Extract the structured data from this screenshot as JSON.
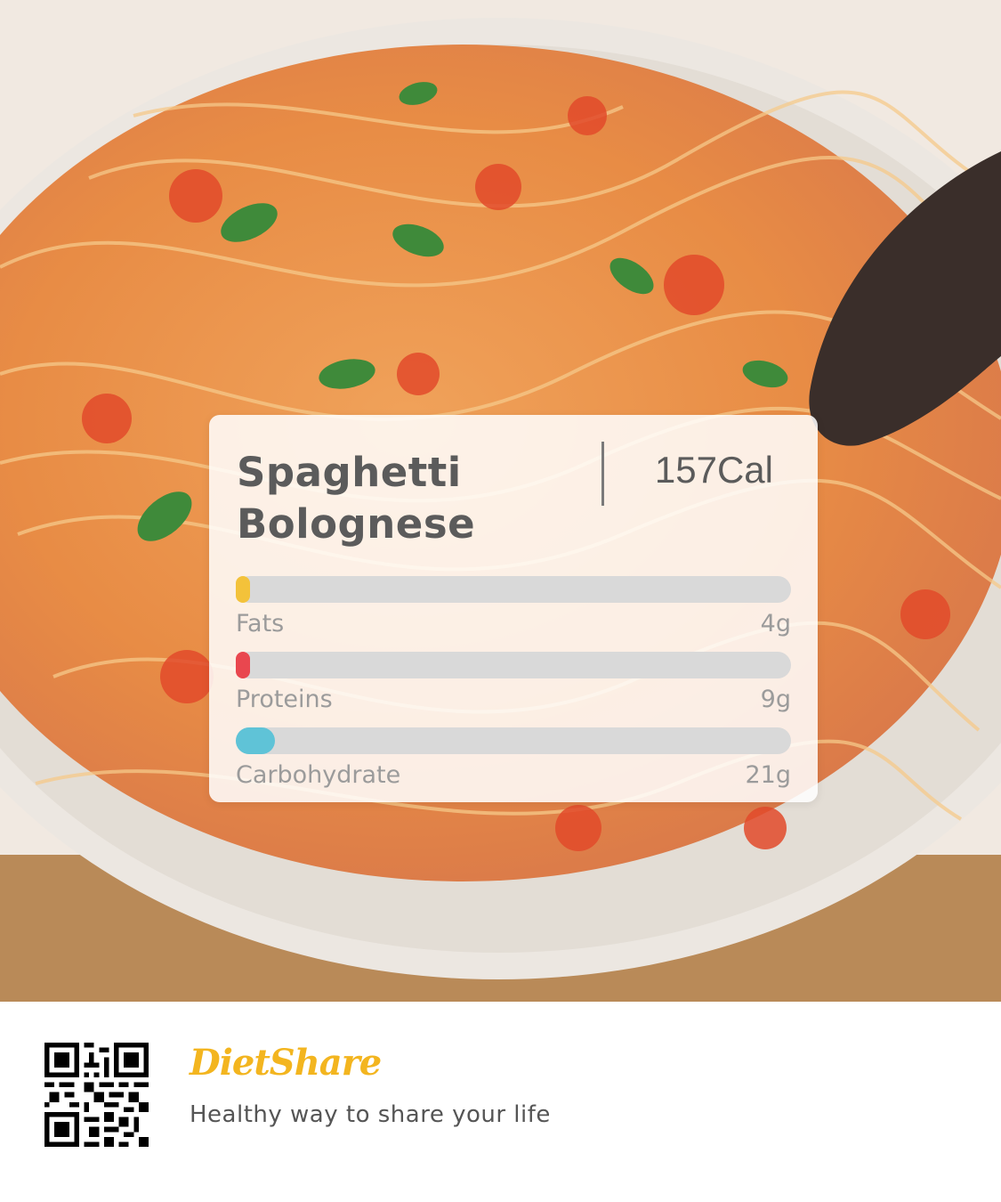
{
  "photo": {
    "subject": "plate of spaghetti with tomato sauce and basil"
  },
  "card": {
    "dish_name": "Spaghetti Bolognese",
    "calories": "157Cal",
    "nutrients": [
      {
        "label": "Fats",
        "value": "4g",
        "color": "#f3c23a",
        "fraction": 0.01
      },
      {
        "label": "Proteins",
        "value": "9g",
        "color": "#e9474f",
        "fraction": 0.01
      },
      {
        "label": "Carbohydrate",
        "value": "21g",
        "color": "#5fc3d7",
        "fraction": 0.07
      }
    ]
  },
  "footer": {
    "qr_icon": "qr-code-icon",
    "brand": "DietShare",
    "brand_color": "#f3b51f",
    "tagline": "Healthy way to share your life"
  }
}
